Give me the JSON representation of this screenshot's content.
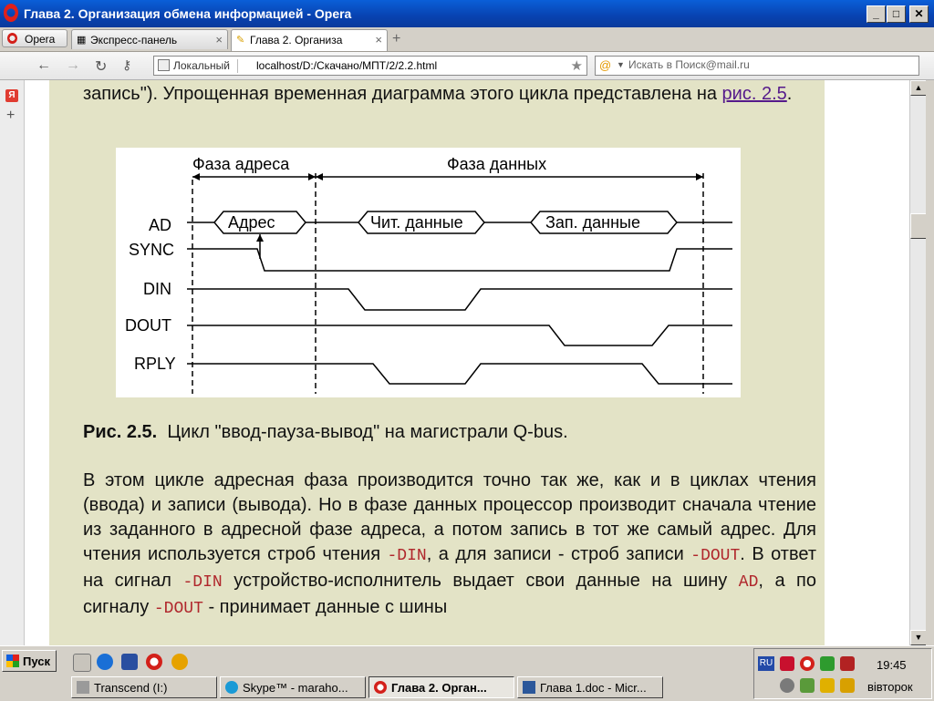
{
  "window": {
    "title": "Глава 2. Организация обмена информацией - Opera",
    "minimize": "_",
    "maximize": "□",
    "close": "✕"
  },
  "tabs": {
    "menu_label": "Opera",
    "items": [
      {
        "label": "Экспресс-панель",
        "icon": "grid-icon",
        "close": "×"
      },
      {
        "label": "Глава 2. Организа",
        "icon": "page-icon",
        "close": "×"
      }
    ],
    "new_tab": "+"
  },
  "nav": {
    "security_label": "Локальный",
    "url": "localhost/D:/Скачано/МПТ/2/2.2.html",
    "search_placeholder": "Искать в Поиск@mail.ru"
  },
  "sidebar": {
    "ya_label": "Я",
    "add_label": "+"
  },
  "content": {
    "para_top_a": "запись\"). Упрощенная временная диаграмма этого цикла представлена на",
    "fig_link": "рис. 2.5",
    "para_top_b": ".",
    "figure": {
      "phase_address": "Фаза адреса",
      "phase_data": "Фаза данных",
      "signals": [
        "AD",
        "SYNC",
        "DIN",
        "DOUT",
        "RPLY"
      ],
      "bus_labels": [
        "Адрес",
        "Чит. данные",
        "Зап. данные"
      ]
    },
    "caption_num": "Рис. 2.5.",
    "caption_text": "Цикл \"ввод-пауза-вывод\" на магистрали Q-bus.",
    "body": {
      "t1": "В этом цикле адресная фаза производится точно так же, как и в циклах чтения (ввода) и записи (вывода). Но в фазе данных процессор производит сначала чтение из заданного в адресной фазе адреса, а потом запись в тот же самый адрес. Для чтения используется строб чтения",
      "s1": "-DIN",
      "t2": ", а для записи - строб записи",
      "s2": "-DOUT",
      "t3": ". В ответ на сигнал",
      "s3": "-DIN",
      "t4": "устройство-исполнитель выдает свои данные на шину",
      "s4": "AD",
      "t5": ", а по сигналу",
      "s5": "-DOUT",
      "t6": "- принимает данные с шины"
    }
  },
  "scrollbar": {
    "up": "▲",
    "down": "▼"
  },
  "taskbar": {
    "start_label": "Пуск",
    "tasks": [
      {
        "label": "Transcend (I:)"
      },
      {
        "label": "Skype™ - maraho..."
      },
      {
        "label": "Глава 2. Орган..."
      },
      {
        "label": "Глава 1.doc - Micr..."
      }
    ],
    "tray": {
      "lang": "RU",
      "time": "19:45",
      "day": "вівторок"
    }
  },
  "colors": {
    "content_bg": "#e3e3c6",
    "signal_code": "#b0272c",
    "link": "#551a8b"
  }
}
